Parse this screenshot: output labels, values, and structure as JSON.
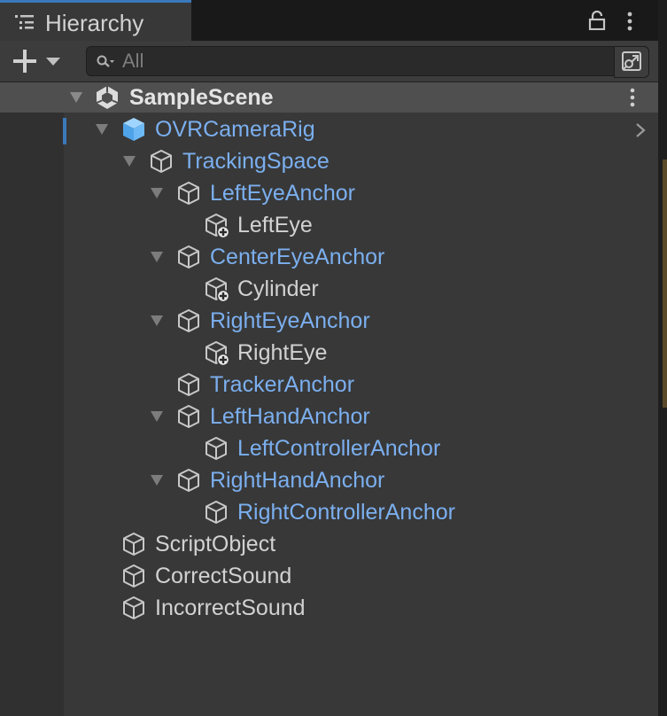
{
  "window": {
    "tab_title": "Hierarchy"
  },
  "toolbar": {
    "search_placeholder": "All"
  },
  "scene": {
    "name": "SampleScene"
  },
  "tree": [
    {
      "label": "OVRCameraRig",
      "kind": "prefab",
      "icon": "prefab-cube-icon",
      "expanded": true,
      "selected": true
    },
    {
      "label": "TrackingSpace",
      "kind": "prefab",
      "icon": "cube-icon",
      "expanded": true
    },
    {
      "label": "LeftEyeAnchor",
      "kind": "prefab",
      "icon": "cube-icon",
      "expanded": true
    },
    {
      "label": "LeftEye",
      "kind": "normal",
      "icon": "cube-added-icon"
    },
    {
      "label": "CenterEyeAnchor",
      "kind": "prefab",
      "icon": "cube-icon",
      "expanded": true
    },
    {
      "label": "Cylinder",
      "kind": "normal",
      "icon": "cube-added-icon"
    },
    {
      "label": "RightEyeAnchor",
      "kind": "prefab",
      "icon": "cube-icon",
      "expanded": true
    },
    {
      "label": "RightEye",
      "kind": "normal",
      "icon": "cube-added-icon"
    },
    {
      "label": "TrackerAnchor",
      "kind": "prefab",
      "icon": "cube-icon"
    },
    {
      "label": "LeftHandAnchor",
      "kind": "prefab",
      "icon": "cube-icon",
      "expanded": true
    },
    {
      "label": "LeftControllerAnchor",
      "kind": "prefab",
      "icon": "cube-icon"
    },
    {
      "label": "RightHandAnchor",
      "kind": "prefab",
      "icon": "cube-icon",
      "expanded": true
    },
    {
      "label": "RightControllerAnchor",
      "kind": "prefab",
      "icon": "cube-icon"
    },
    {
      "label": "ScriptObject",
      "kind": "normal",
      "icon": "cube-icon"
    },
    {
      "label": "CorrectSound",
      "kind": "normal",
      "icon": "cube-icon"
    },
    {
      "label": "IncorrectSound",
      "kind": "normal",
      "icon": "cube-icon"
    }
  ],
  "colors": {
    "prefab_text": "#7bafef",
    "normal_text": "#d2d2d2",
    "selection_accent": "#3a79bb",
    "panel_bg": "#383838"
  }
}
